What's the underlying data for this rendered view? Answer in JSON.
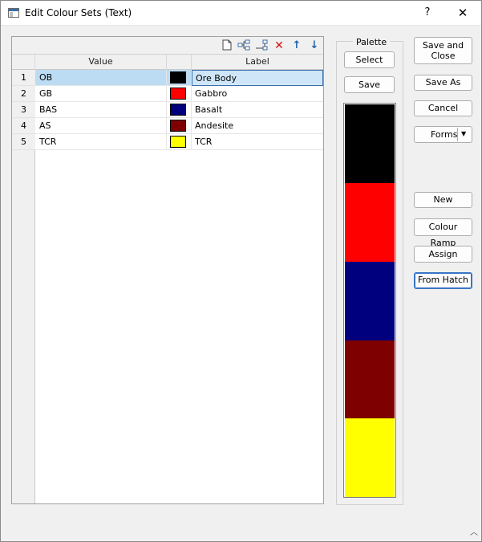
{
  "window": {
    "title": "Edit Colour Sets (Text)",
    "help_label": "?",
    "close_label": "✕"
  },
  "toolbar": {
    "icons": [
      "new-row-icon",
      "insert-row-icon",
      "append-row-icon",
      "delete-row-icon",
      "move-up-icon",
      "move-down-icon"
    ]
  },
  "grid": {
    "columns": [
      "Value",
      "Label"
    ],
    "rows": [
      {
        "num": "1",
        "value": "OB",
        "color": "#000000",
        "label": "Ore Body"
      },
      {
        "num": "2",
        "value": "GB",
        "color": "#ff0000",
        "label": "Gabbro"
      },
      {
        "num": "3",
        "value": "BAS",
        "color": "#00007f",
        "label": "Basalt"
      },
      {
        "num": "4",
        "value": "AS",
        "color": "#7f0000",
        "label": "Andesite"
      },
      {
        "num": "5",
        "value": "TCR",
        "color": "#ffff00",
        "label": "TCR"
      }
    ]
  },
  "palette": {
    "title": "Palette",
    "select_label": "Select",
    "save_label": "Save",
    "colors": [
      "#000000",
      "#ff0000",
      "#00007f",
      "#7f0000",
      "#ffff00"
    ]
  },
  "buttons": {
    "save_close": "Save and Close",
    "save_as": "Save As",
    "cancel": "Cancel",
    "forms": "Forms",
    "new": "New",
    "colour_ramp": "Colour Ramp",
    "assign": "Assign",
    "from_hatch": "From Hatch"
  }
}
